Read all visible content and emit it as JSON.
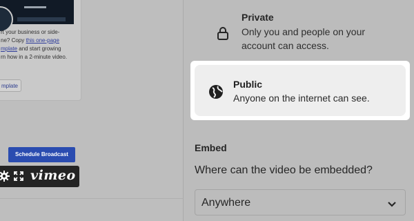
{
  "preview": {
    "text_lines": "rt your business or side-\nne? Copy ",
    "link1": "this one-page",
    "text_mid": "\n",
    "link2": "mplate",
    "text_after": " and start growing\nrn how in a 2-minute video.",
    "use_template_label": "mplate",
    "schedule_label": "Schedule Broadcast"
  },
  "player": {
    "brand": "vimeo",
    "icons": [
      "gear-icon",
      "expand-icon"
    ]
  },
  "privacy": {
    "private": {
      "title": "Private",
      "description": "Only you and people on your\naccount can access.",
      "icon": "lock-icon"
    },
    "public": {
      "title": "Public",
      "description": "Anyone on the internet can see.",
      "icon": "globe-icon",
      "selected": true
    }
  },
  "embed": {
    "heading": "Embed",
    "question": "Where can the video be embedded?",
    "selected_value": "Anywhere"
  },
  "colors": {
    "overlay": "#bdbdbd",
    "highlight_bg": "#ffffff",
    "schedule_button": "#2a4cb0",
    "player_bar": "#242424"
  }
}
